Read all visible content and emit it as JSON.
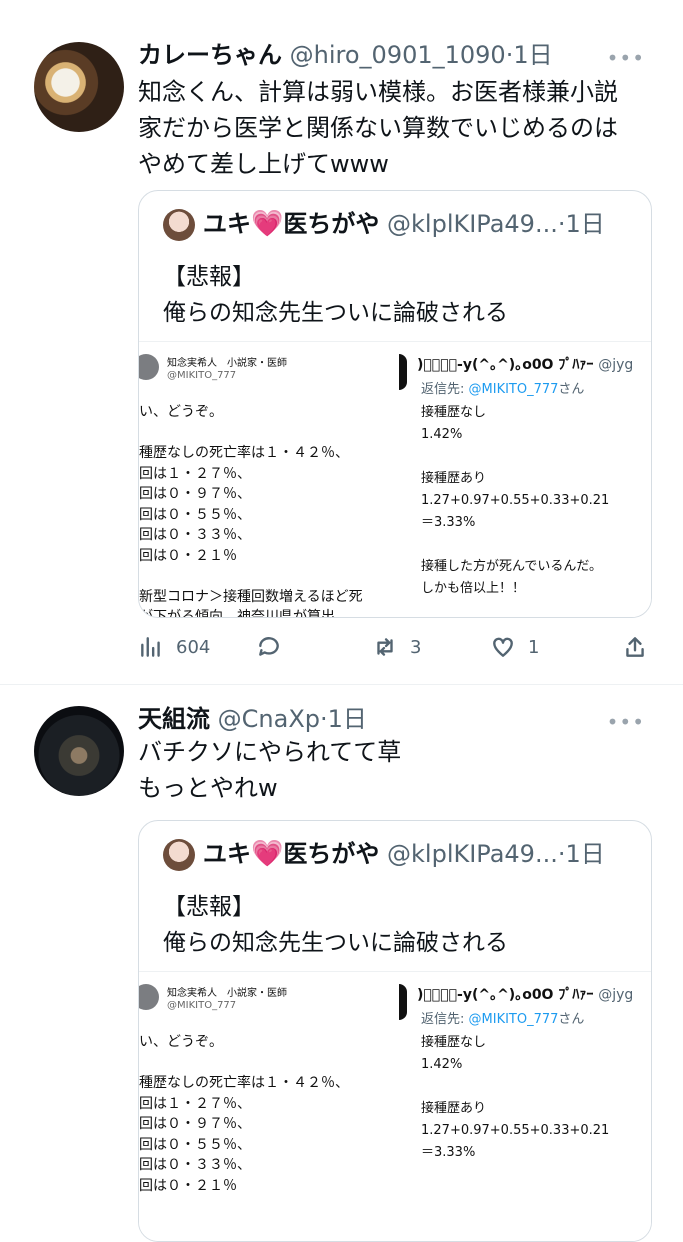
{
  "tweets": [
    {
      "name": "カレーちゃん",
      "handle": "@hiro_0901_1090",
      "time": "1日",
      "text": "知念くん、計算は弱い模様。お医者様兼小説家だから医学と関係ない算数でいじめるのはやめて差し上げてwww",
      "text_lines": [
        "知念くん、計算は弱い模様。お医者様兼小説",
        "家だから医学と関係ない算数でいじめるのは",
        "やめて差し上げてwww"
      ],
      "quote": {
        "name": "ユキ",
        "heart": "💗",
        "name2": "医ちがや",
        "handle": "@klplKIPa49...",
        "time": "1日",
        "line1": "【悲報】",
        "line2": "俺らの知念先生ついに論破される",
        "image": {
          "left_name": "知念実希人　小説家・医師",
          "left_handle": "@MIKITO_777",
          "left_text": "い、どうぞ。\n\n種歴なしの死亡率は１・４２％、\n回は１・２７％、\n回は０・９７％、\n回は０・５５％、\n回は０・３３％、\n回は０・２１％\n\n新型コロナ＞接種回数増えるほど死\nが下がる傾向　神奈川県が算出",
          "right_head": ")ﾟﾟﾟﾟ-y(^｡^)｡o0O ﾌﾟﾊｧｰ",
          "right_handle": "@jyg",
          "reply_prefix": "返信先: ",
          "reply_mention": "@MIKITO_777",
          "reply_suffix": "さん",
          "right_text": "接種歴なし\n1.42%\n\n接種歴あり\n1.27+0.97+0.55+0.33+0.21\n＝3.33%\n\n接種した方が死んでいるんだ。\nしかも倍以上！！"
        }
      },
      "stats": {
        "views": "604",
        "retweets": "3",
        "likes": "1"
      }
    },
    {
      "name": "天組流",
      "handle": "@CnaXp",
      "time": "1日",
      "text_lines": [
        "バチクソにやられてて草",
        "もっとやれw"
      ],
      "quote": {
        "name": "ユキ",
        "heart": "💗",
        "name2": "医ちがや",
        "handle": "@klplKIPa49...",
        "time": "1日",
        "line1": "【悲報】",
        "line2": "俺らの知念先生ついに論破される",
        "image": {
          "left_name": "知念実希人　小説家・医師",
          "left_handle": "@MIKITO_777",
          "left_text": "い、どうぞ。\n\n種歴なしの死亡率は１・４２％、\n回は１・２７％、\n回は０・９７％、\n回は０・５５％、\n回は０・３３％、\n回は０・２１％",
          "right_head": ")ﾟﾟﾟﾟ-y(^｡^)｡o0O ﾌﾟﾊｧｰ",
          "right_handle": "@jyg",
          "reply_prefix": "返信先: ",
          "reply_mention": "@MIKITO_777",
          "reply_suffix": "さん",
          "right_text": "接種歴なし\n1.42%\n\n接種歴あり\n1.27+0.97+0.55+0.33+0.21\n＝3.33%"
        }
      }
    }
  ],
  "ui": {
    "separator": "·",
    "more_icon": "more-horizontal-icon",
    "views_icon": "bar-chart-icon",
    "reply_icon": "reply-bubble-icon",
    "retweet_icon": "retweet-icon",
    "like_icon": "heart-icon",
    "share_icon": "share-icon"
  }
}
